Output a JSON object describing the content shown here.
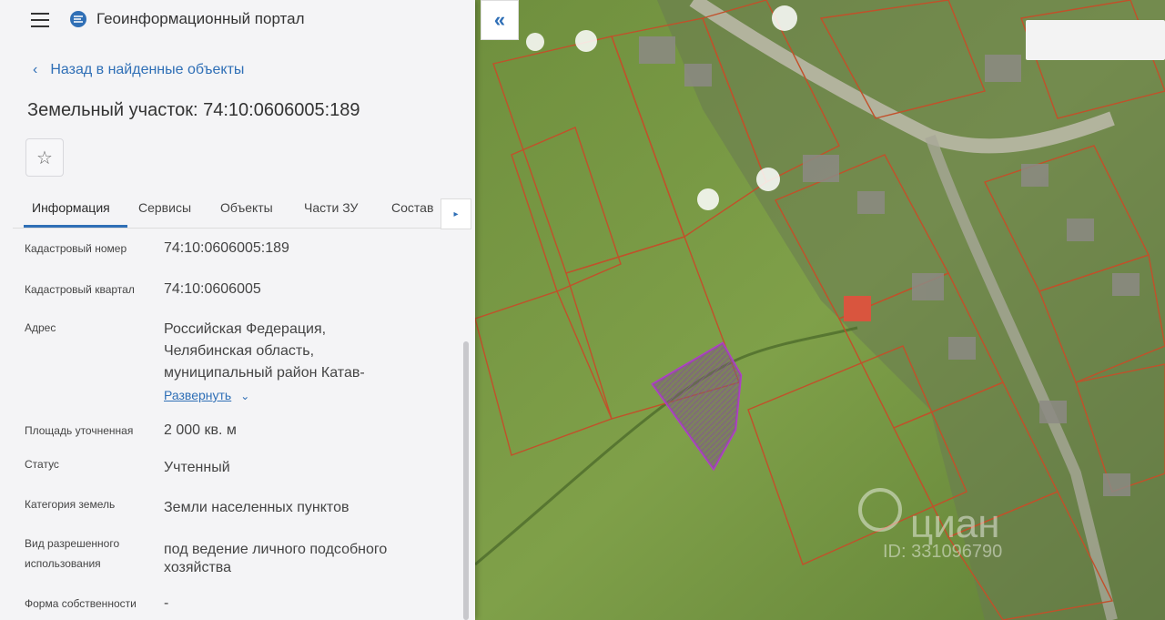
{
  "header": {
    "app_title": "Геоинформационный портал"
  },
  "nav": {
    "back_label": "Назад в найденные объекты"
  },
  "parcel": {
    "title": "Земельный участок: 74:10:0606005:189"
  },
  "tabs": [
    {
      "label": "Информация",
      "active": true
    },
    {
      "label": "Сервисы"
    },
    {
      "label": "Объекты"
    },
    {
      "label": "Части ЗУ"
    },
    {
      "label": "Состав"
    }
  ],
  "fields": {
    "cadastral_number": {
      "label": "Кадастровый номер",
      "value": "74:10:0606005:189"
    },
    "cadastral_quarter": {
      "label": "Кадастровый квартал",
      "value": "74:10:0606005"
    },
    "address": {
      "label": "Адрес",
      "line1": "Российская Федерация,",
      "line2": "Челябинская область,",
      "line3": "муниципальный район Катав-",
      "expand_label": "Развернуть"
    },
    "area": {
      "label": "Площадь уточненная",
      "value": "2 000 кв. м"
    },
    "status": {
      "label": "Статус",
      "value": "Учтенный"
    },
    "land_category": {
      "label": "Категория земель",
      "value": "Земли населенных пунктов"
    },
    "permitted_use": {
      "label1": "Вид разрешенного",
      "label2": "использования",
      "value1": "под ведение личного подсобного",
      "value2": "хозяйства"
    },
    "ownership": {
      "label": "Форма собственности",
      "value": "-"
    }
  },
  "watermark": {
    "brand": "циан",
    "id": "ID: 331096790"
  },
  "colors": {
    "accent": "#2f6fb6",
    "selected_parcel": "#b040c8",
    "parcel_border": "#c2502a"
  },
  "icons": {
    "menu": "hamburger-icon",
    "logo": "logo-icon",
    "back": "chevron-left-icon",
    "favorite": "star-icon",
    "tabs_next": "chevron-right-icon",
    "expand": "chevron-down-icon",
    "collapse": "double-chevron-left-icon"
  }
}
